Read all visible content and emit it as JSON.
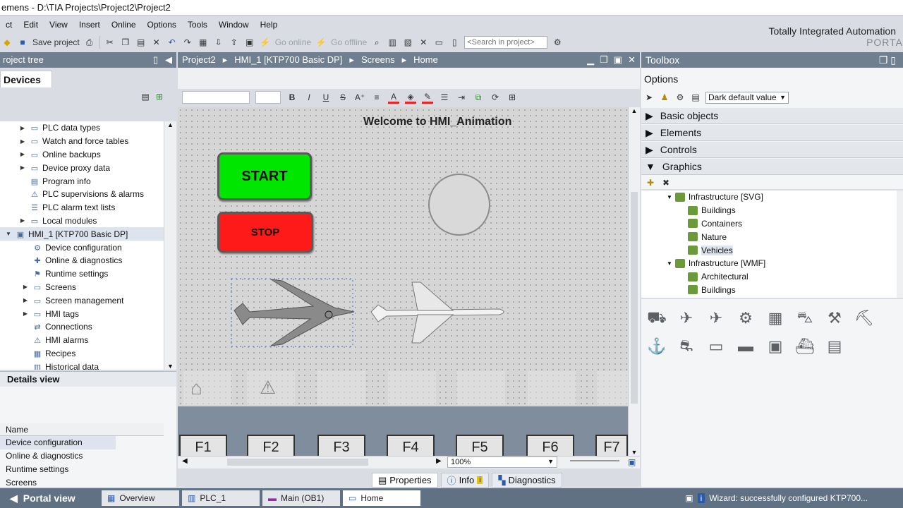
{
  "window": {
    "title": "emens - D:\\TIA Projects\\Project2\\Project2"
  },
  "menu": [
    "ct",
    "Edit",
    "View",
    "Insert",
    "Online",
    "Options",
    "Tools",
    "Window",
    "Help"
  ],
  "toolbar": {
    "save_label": "Save project",
    "go_online": "Go online",
    "go_offline": "Go offline",
    "search_placeholder": "<Search in project>"
  },
  "brand": {
    "line1": "Totally Integrated Automation",
    "line2": "PORTA"
  },
  "project_tree": {
    "title": "roject tree",
    "devices_tab": "Devices",
    "items": [
      {
        "label": "PLC data types",
        "arrow": "▶",
        "icon": "folder-icon"
      },
      {
        "label": "Watch and force tables",
        "arrow": "▶",
        "icon": "folder-icon"
      },
      {
        "label": "Online backups",
        "arrow": "▶",
        "icon": "folder-icon"
      },
      {
        "label": "Device proxy data",
        "arrow": "▶",
        "icon": "folder-icon"
      },
      {
        "label": "Program info",
        "arrow": "",
        "icon": "info-icon"
      },
      {
        "label": "PLC supervisions & alarms",
        "arrow": "",
        "icon": "alarm-icon"
      },
      {
        "label": "PLC alarm text lists",
        "arrow": "",
        "icon": "list-icon"
      },
      {
        "label": "Local modules",
        "arrow": "▶",
        "icon": "folder-icon"
      },
      {
        "label": "HMI_1 [KTP700 Basic DP]",
        "arrow": "▼",
        "icon": "hmi-icon",
        "selected": true
      },
      {
        "label": "Device configuration",
        "arrow": "",
        "icon": "config-icon"
      },
      {
        "label": "Online & diagnostics",
        "arrow": "",
        "icon": "diagnostics-icon"
      },
      {
        "label": "Runtime settings",
        "arrow": "",
        "icon": "settings-icon"
      },
      {
        "label": "Screens",
        "arrow": "▶",
        "icon": "folder-icon"
      },
      {
        "label": "Screen management",
        "arrow": "▶",
        "icon": "folder-icon"
      },
      {
        "label": "HMI tags",
        "arrow": "▶",
        "icon": "folder-icon"
      },
      {
        "label": "Connections",
        "arrow": "",
        "icon": "connections-icon"
      },
      {
        "label": "HMI alarms",
        "arrow": "",
        "icon": "alarm-icon"
      },
      {
        "label": "Recipes",
        "arrow": "",
        "icon": "recipes-icon"
      },
      {
        "label": "Historical data",
        "arrow": "",
        "icon": "history-icon"
      }
    ]
  },
  "details_view": {
    "title": "Details view",
    "column": "Name",
    "rows": [
      "Device configuration",
      "Online & diagnostics",
      "Runtime settings",
      "Screens"
    ]
  },
  "editor": {
    "breadcrumb": [
      "Project2",
      "HMI_1 [KTP700 Basic DP]",
      "Screens",
      "Home"
    ],
    "welcome": "Welcome to HMI_Animation",
    "start": "START",
    "stop": "STOP",
    "fkeys": [
      "F1",
      "F2",
      "F3",
      "F4",
      "F5",
      "F6",
      "F7"
    ],
    "zoom": "100%"
  },
  "inspector_tabs": [
    "Properties",
    "Info",
    "Diagnostics"
  ],
  "toolbox": {
    "title": "Toolbox",
    "options": "Options",
    "style_select": "Dark default value",
    "categories": [
      {
        "label": "Basic objects",
        "arrow": "▶"
      },
      {
        "label": "Elements",
        "arrow": "▶"
      },
      {
        "label": "Controls",
        "arrow": "▶"
      },
      {
        "label": "Graphics",
        "arrow": "▼"
      }
    ],
    "graphics_tree": [
      {
        "label": "Infrastructure [SVG]",
        "level": 1
      },
      {
        "label": "Buildings",
        "level": 2
      },
      {
        "label": "Containers",
        "level": 2
      },
      {
        "label": "Nature",
        "level": 2
      },
      {
        "label": "Vehicles",
        "level": 2,
        "selected": true
      },
      {
        "label": "Infrastructure [WMF]",
        "level": 1
      },
      {
        "label": "Architectural",
        "level": 2
      },
      {
        "label": "Buildings",
        "level": 2
      }
    ],
    "vehicle_icons": [
      "truck-icon",
      "plane-icon",
      "plane-icon",
      "tractor-icon",
      "harvester-icon",
      "car-icon",
      "forklift-icon",
      "excavator-icon",
      "crane-icon",
      "loader-icon",
      "trailer-icon",
      "tanker-icon",
      "bulldozer-icon",
      "boat-icon",
      "van-icon"
    ]
  },
  "taskbar": {
    "portal_view": "Portal view",
    "tasks": [
      "Overview",
      "PLC_1",
      "Main (OB1)",
      "Home"
    ],
    "status": "Wizard: successfully configured KTP700..."
  }
}
